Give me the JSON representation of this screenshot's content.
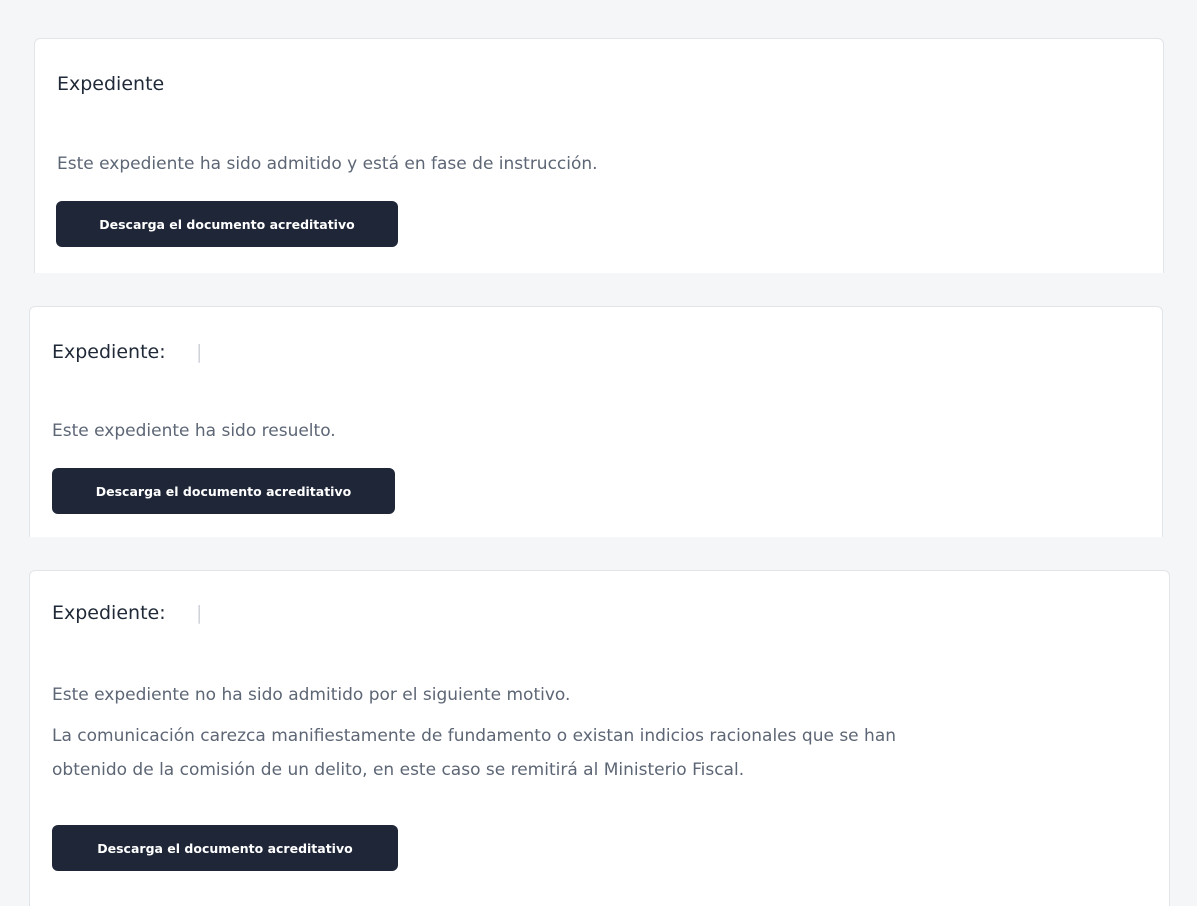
{
  "cards": [
    {
      "title": "Expediente",
      "status": "Este expediente ha sido admitido y está en fase de instrucción.",
      "reason": "",
      "button_label": "Descarga el documento acreditativo"
    },
    {
      "title": "Expediente:",
      "status": "Este expediente ha sido resuelto.",
      "reason": "",
      "button_label": "Descarga el documento acreditativo"
    },
    {
      "title": "Expediente:",
      "status": "Este expediente no ha sido admitido por el siguiente motivo.",
      "reason_lines": [
        "La comunicación carezca manifiestamente de fundamento o existan indicios racionales que se han",
        "obtenido de la comisión de un delito, en este caso se remitirá al Ministerio Fiscal."
      ],
      "button_label": "Descarga el documento acreditativo"
    }
  ]
}
